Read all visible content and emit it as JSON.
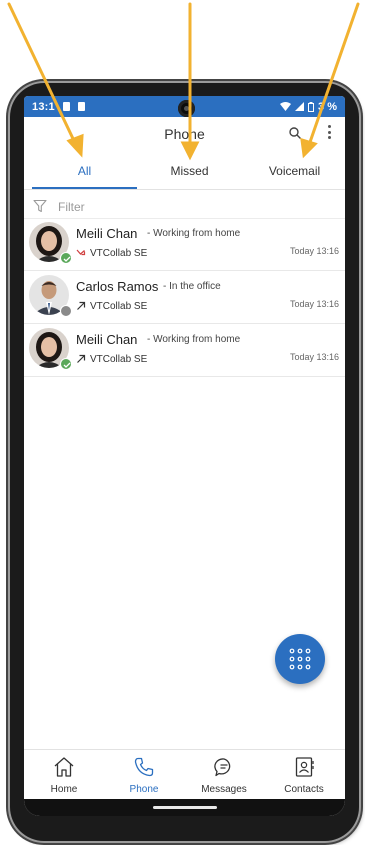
{
  "status_bar": {
    "time": "13:1",
    "battery": "3 %"
  },
  "header": {
    "title": "Phone"
  },
  "tabs": [
    {
      "label": "All",
      "active": true
    },
    {
      "label": "Missed",
      "active": false
    },
    {
      "label": "Voicemail",
      "active": false
    }
  ],
  "filter": {
    "placeholder": "Filter"
  },
  "calls": [
    {
      "name": "Meili Chan",
      "status": "- Working from home",
      "account": "VTCollab SE",
      "time": "Today 13:16",
      "presence": "available",
      "direction": "missed"
    },
    {
      "name": "Carlos Ramos",
      "status": "- In the office",
      "account": "VTCollab SE",
      "time": "Today 13:16",
      "presence": "offline",
      "direction": "outgoing"
    },
    {
      "name": "Meili Chan",
      "status": "- Working from home",
      "account": "VTCollab SE",
      "time": "Today 13:16",
      "presence": "available",
      "direction": "outgoing"
    }
  ],
  "bottom_nav": [
    {
      "label": "Home",
      "icon": "home-icon",
      "active": false
    },
    {
      "label": "Phone",
      "icon": "phone-icon",
      "active": true
    },
    {
      "label": "Messages",
      "icon": "messages-icon",
      "active": false
    },
    {
      "label": "Contacts",
      "icon": "contacts-icon",
      "active": false
    }
  ],
  "colors": {
    "accent": "#2b6fc0",
    "annotation": "#f2b230",
    "available": "#5aa85a",
    "missed": "#d04040"
  }
}
